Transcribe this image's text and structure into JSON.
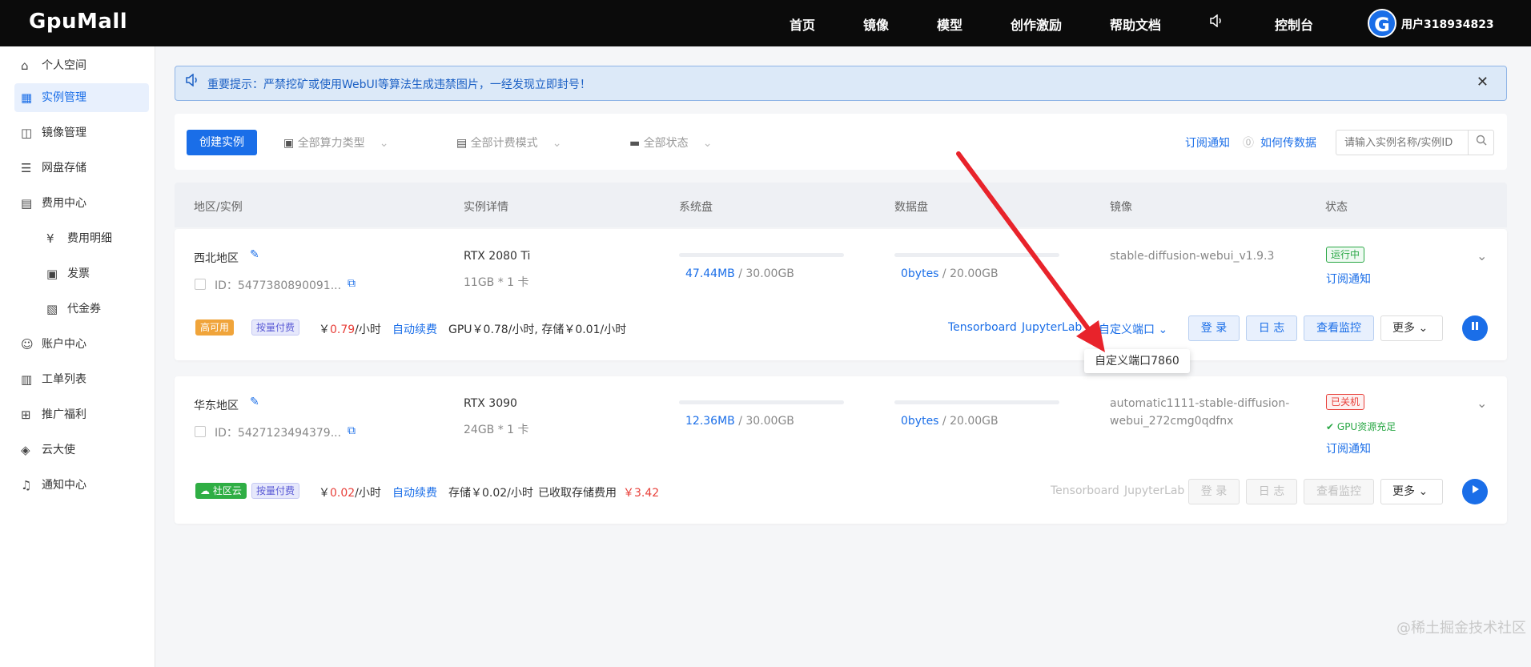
{
  "topbar": {
    "logo": "GpuMall",
    "nav": [
      "首页",
      "镜像",
      "模型",
      "创作激励",
      "帮助文档"
    ],
    "console": "控制台",
    "avatar_letter": "G",
    "username": "用户318934823"
  },
  "sidebar": {
    "items": [
      {
        "label": "个人空间",
        "icon": "home-icon"
      },
      {
        "label": "实例管理",
        "icon": "grid-icon"
      },
      {
        "label": "镜像管理",
        "icon": "mirror-icon"
      },
      {
        "label": "网盘存储",
        "icon": "storage-icon"
      },
      {
        "label": "费用中心",
        "icon": "billing-icon"
      },
      {
        "label": "费用明细",
        "icon": "yen-icon"
      },
      {
        "label": "发票",
        "icon": "invoice-icon"
      },
      {
        "label": "代金券",
        "icon": "voucher-icon"
      },
      {
        "label": "账户中心",
        "icon": "user-icon"
      },
      {
        "label": "工单列表",
        "icon": "ticket-icon"
      },
      {
        "label": "推广福利",
        "icon": "gift-icon"
      },
      {
        "label": "云大使",
        "icon": "diamond-icon"
      },
      {
        "label": "通知中心",
        "icon": "bell-icon"
      }
    ]
  },
  "notice": {
    "text": "重要提示：严禁挖矿或使用WebUI等算法生成违禁图片，一经发现立即封号！"
  },
  "toolbar": {
    "create_label": "创建实例",
    "filters": [
      "全部算力类型",
      "全部计费模式",
      "全部状态"
    ],
    "subscribe_label": "订阅通知",
    "transfer_label": "如何传数据",
    "search_placeholder": "请输入实例名称/实例ID"
  },
  "table": {
    "headers": [
      "地区/实例",
      "实例详情",
      "系统盘",
      "数据盘",
      "镜像",
      "状态"
    ]
  },
  "instances": [
    {
      "region": "西北地区",
      "id": "ID：5477380890091...",
      "gpu": "RTX 2080 Ti",
      "spec": "11GB * 1 卡",
      "sys_used": "47.44MB",
      "sys_total": " / 30.00GB",
      "data_used": "0bytes",
      "data_total": " / 20.00GB",
      "image": "stable-diffusion-webui_v1.9.3",
      "status": "运行中",
      "subscribe": "订阅通知",
      "tag1": "高可用",
      "tag2": "按量付费",
      "price_prefix": "￥",
      "price": "0.79",
      "price_unit": "/小时",
      "renew": "自动续费",
      "detail": "GPU￥0.78/小时, 存储￥0.01/小时",
      "tensorboard": "Tensorboard",
      "jupyter": "JupyterLab",
      "custom_port": "自定义端口",
      "login": "登 录",
      "log": "日 志",
      "monitor": "查看监控",
      "more": "更多"
    },
    {
      "region": "华东地区",
      "id": "ID：5427123494379...",
      "gpu": "RTX 3090",
      "spec": "24GB * 1 卡",
      "sys_used": "12.36MB",
      "sys_total": " / 30.00GB",
      "data_used": "0bytes",
      "data_total": " / 20.00GB",
      "image_line1": "automatic1111-stable-diffusion-",
      "image_line2": "webui_272cmg0qdfnx",
      "status": "已关机",
      "gpu_status": "GPU资源充足",
      "subscribe": "订阅通知",
      "tag1": "社区云",
      "tag2": "按量付费",
      "price_prefix": "￥",
      "price": "0.02",
      "price_unit": "/小时",
      "renew": "自动续费",
      "detail": "存储￥0.02/小时",
      "storage_fee_label": "已收取存储费用",
      "storage_fee": "￥3.42",
      "tensorboard": "Tensorboard",
      "jupyter": "JupyterLab",
      "login": "登 录",
      "log": "日 志",
      "monitor": "查看监控",
      "more": "更多"
    }
  ],
  "tooltip": "自定义端口7860",
  "watermark": "@稀土掘金技术社区",
  "colors": {
    "accent": "#1a6ee8",
    "arrow": "#e8232b",
    "running": "#29a745",
    "stopped": "#e8403a"
  }
}
